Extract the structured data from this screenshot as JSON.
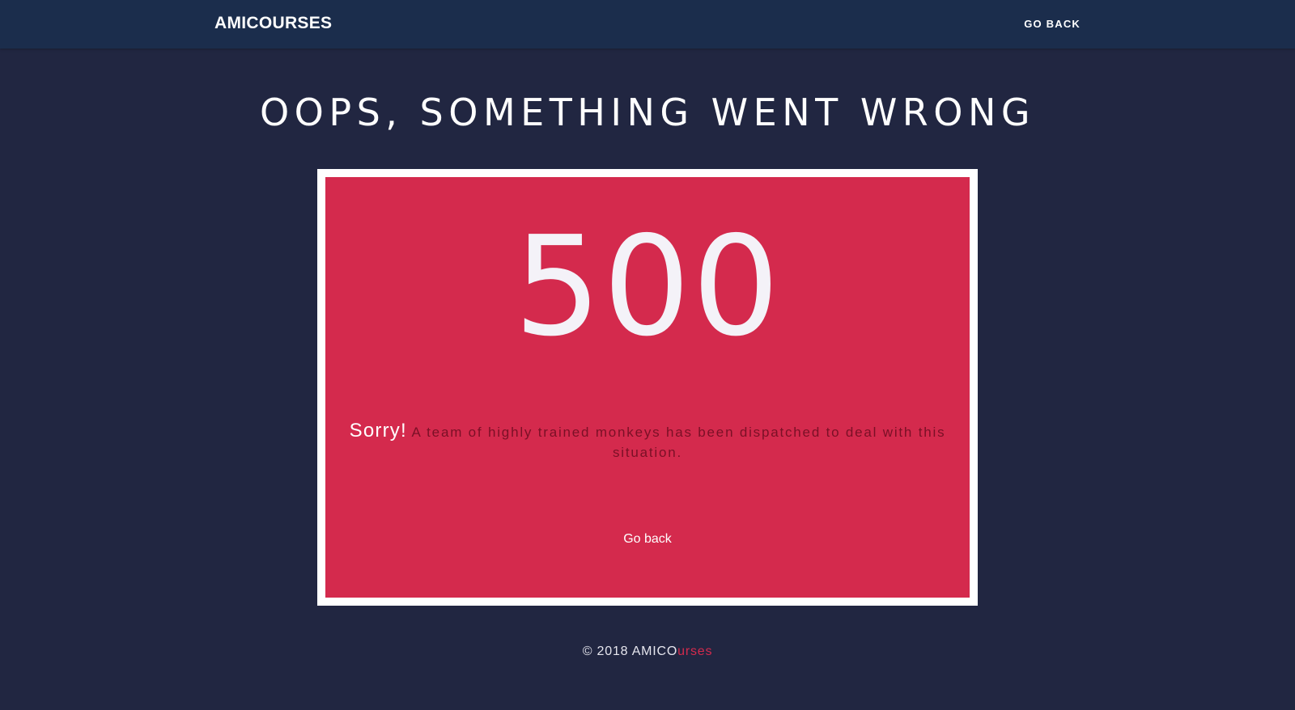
{
  "navbar": {
    "brand": "AMICOURSES",
    "go_back": "GO BACK"
  },
  "page": {
    "title": "OOPS, SOMETHING WENT WRONG"
  },
  "error": {
    "code": "500",
    "sorry": "Sorry!",
    "message": "A team of highly trained monkeys has been dispatched to deal with this situation.",
    "go_back": "Go back"
  },
  "footer": {
    "prefix": "© 2018 AMICO",
    "accent": "urses"
  },
  "colors": {
    "background": "#212641",
    "navbar": "#1b2d4c",
    "card": "#d42a4d",
    "frame": "#ffffff",
    "message_text": "#7a1026"
  }
}
